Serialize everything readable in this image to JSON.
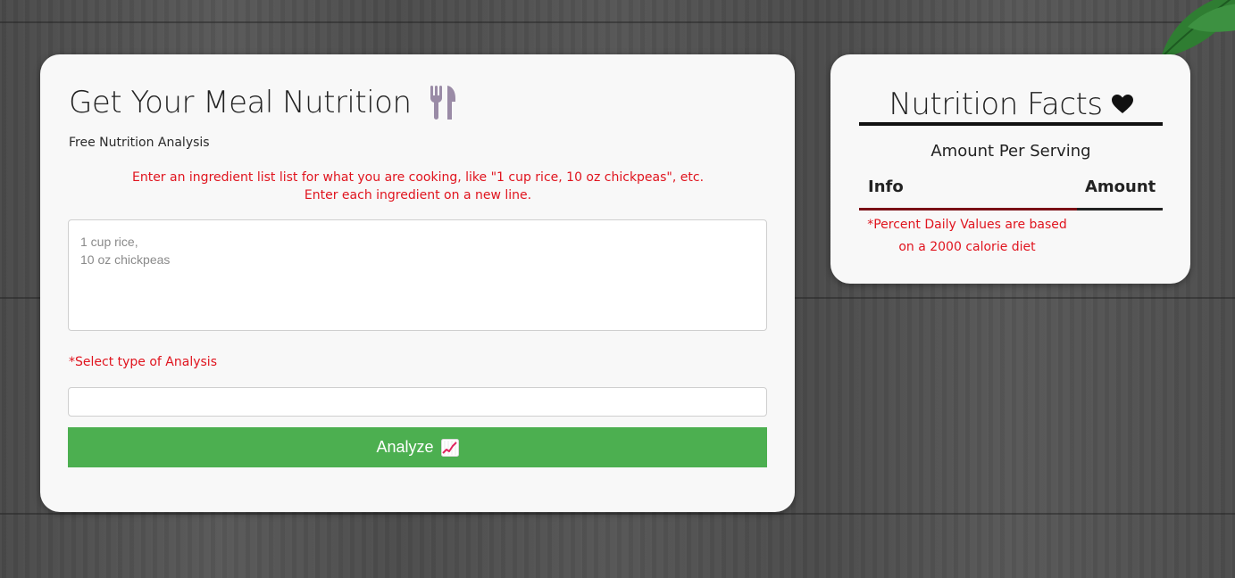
{
  "main": {
    "title": "Get Your Meal Nutrition",
    "title_icon": "utensils-icon",
    "subtitle": "Free Nutrition Analysis",
    "instructions_line1": "Enter an ingredient list list for what you are cooking, like \"1 cup rice, 10 oz chickpeas\", etc.",
    "instructions_line2": "Enter each ingredient on a new line.",
    "ingredients_value": "",
    "ingredients_placeholder": "1 cup rice,\n10 oz chickpeas",
    "select_label": "*Select type of Analysis",
    "select_value": "",
    "analyze_label": "Analyze",
    "analyze_icon": "chart-increasing-icon"
  },
  "facts": {
    "title": "Nutrition Facts",
    "title_icon": "heart-icon",
    "amount_per_serving": "Amount Per Serving",
    "col_info": "Info",
    "col_amount": "Amount",
    "disclaimer": "*Percent Daily Values are based on a 2000 calorie diet"
  },
  "colors": {
    "accent_green": "#4caf50",
    "warning_red": "#e0141e",
    "card_bg": "#f8f8f8",
    "utensils_icon": "#9a8ba6"
  }
}
